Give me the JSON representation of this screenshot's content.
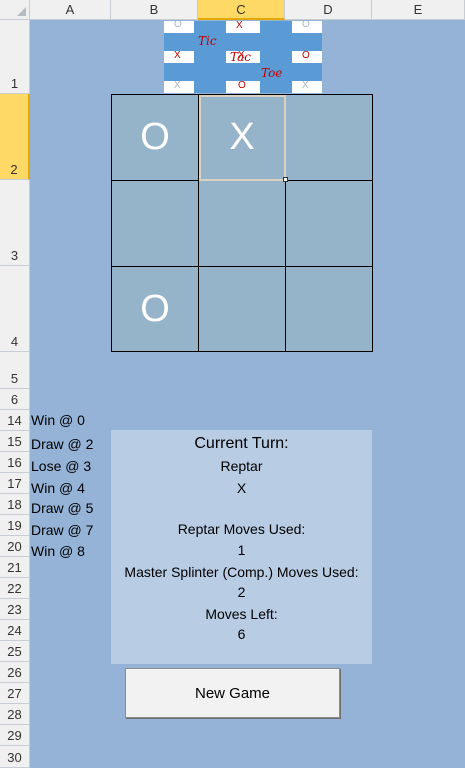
{
  "columns": [
    "A",
    "B",
    "C",
    "D",
    "E"
  ],
  "rows": [
    "1",
    "2",
    "3",
    "4",
    "5",
    "6",
    "14",
    "15",
    "16",
    "17",
    "18",
    "19",
    "20",
    "21",
    "22",
    "23",
    "24",
    "25",
    "26",
    "27",
    "28",
    "29",
    "30"
  ],
  "logo": {
    "tiles": [
      "O",
      "X",
      "O",
      "X",
      "X",
      "O",
      "X",
      "O",
      "X",
      "O",
      "X",
      "O",
      "O",
      "X",
      "O"
    ],
    "words": [
      "Tic",
      "Tac",
      "Toe"
    ]
  },
  "board": [
    "O",
    "X",
    "",
    "",
    "",
    "",
    "O",
    "",
    ""
  ],
  "history": [
    "Win  @ 0",
    "Draw @ 2",
    "Lose @ 3",
    "Win  @ 4",
    "Draw @ 5",
    "Draw @ 7",
    "Win  @ 8"
  ],
  "status": {
    "current_turn_label": "Current Turn:",
    "current_player": "Reptar",
    "current_symbol": "X",
    "player_moves_label": "Reptar Moves Used:",
    "player_moves": "1",
    "computer_moves_label": "Master Splinter (Comp.) Moves Used:",
    "computer_moves": "2",
    "moves_left_label": "Moves Left:",
    "moves_left": "6"
  },
  "new_game_label": "New Game",
  "colors": {
    "sheet_bg": "#95b3d7",
    "cell_bg": "#95b3c9",
    "panel_bg": "#b8cce4",
    "logo_blue": "#5b9bd5",
    "logo_letter": "#c00000"
  }
}
